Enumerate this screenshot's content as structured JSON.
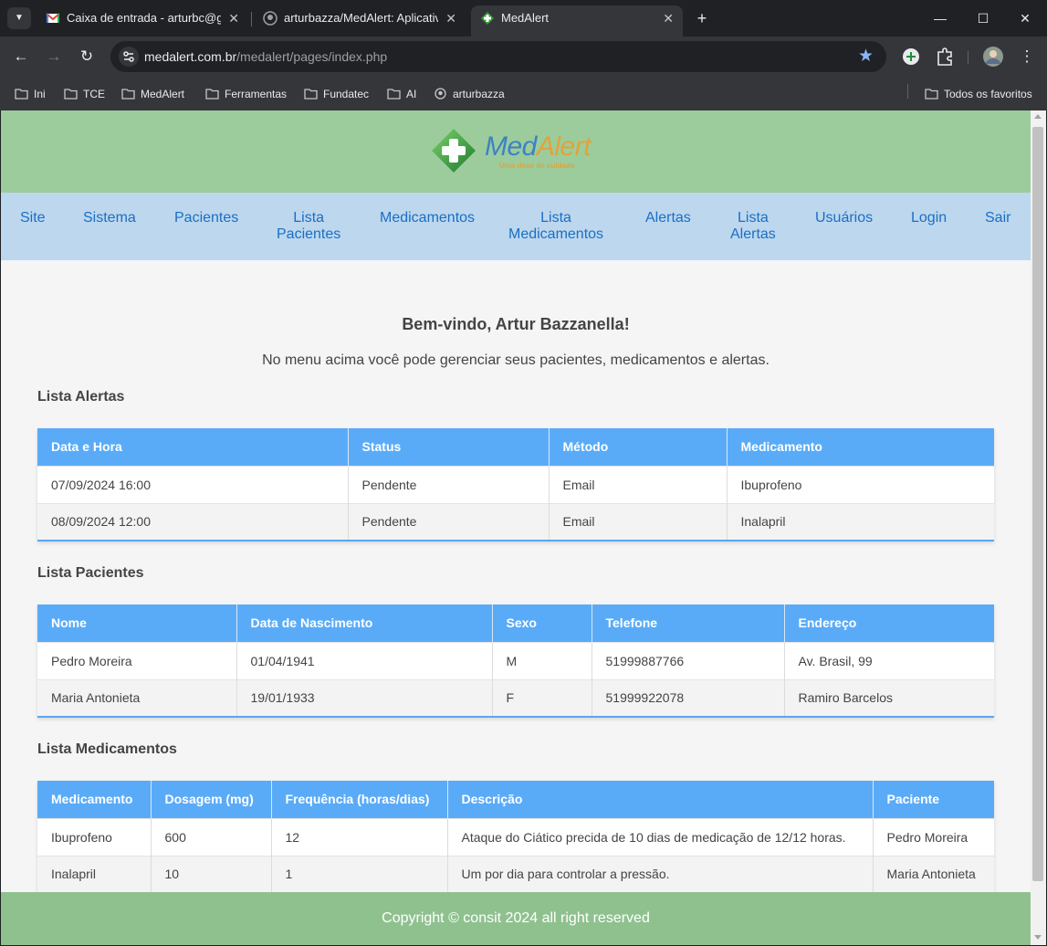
{
  "browser": {
    "tabs": [
      {
        "title": "Caixa de entrada - arturbc@gmail.com",
        "active": false
      },
      {
        "title": "arturbazza/MedAlert: Aplicativo",
        "active": false
      },
      {
        "title": "MedAlert",
        "active": true
      }
    ],
    "url_host": "medalert.com.br",
    "url_path": "/medalert/pages/index.php",
    "bookmarks": [
      "Ini",
      "TCE",
      "MedAlert",
      "Ferramentas",
      "Fundatec",
      "AI",
      "arturbazza"
    ],
    "all_bookmarks_label": "Todos os favoritos"
  },
  "site": {
    "logo": {
      "med": "Med",
      "alert": "Alert",
      "tagline": "Uma dose de cuidado"
    },
    "nav": [
      {
        "label": "Site"
      },
      {
        "label": "Sistema"
      },
      {
        "label": "Pacientes"
      },
      {
        "label": "Lista\nPacientes"
      },
      {
        "label": "Medicamentos"
      },
      {
        "label": "Lista\nMedicamentos"
      },
      {
        "label": "Alertas"
      },
      {
        "label": "Lista\nAlertas"
      },
      {
        "label": "Usuários"
      },
      {
        "label": "Login"
      },
      {
        "label": "Sair"
      }
    ],
    "welcome": "Bem-vindo, Artur Bazzanella!",
    "subtitle": "No menu acima você pode gerenciar seus pacientes, medicamentos e alertas.",
    "alerts": {
      "title": "Lista Alertas",
      "headers": [
        "Data e Hora",
        "Status",
        "Método",
        "Medicamento"
      ],
      "rows": [
        [
          "07/09/2024 16:00",
          "Pendente",
          "Email",
          "Ibuprofeno"
        ],
        [
          "08/09/2024 12:00",
          "Pendente",
          "Email",
          "Inalapril"
        ]
      ]
    },
    "patients": {
      "title": "Lista Pacientes",
      "headers": [
        "Nome",
        "Data de Nascimento",
        "Sexo",
        "Telefone",
        "Endereço"
      ],
      "rows": [
        [
          "Pedro Moreira",
          "01/04/1941",
          "M",
          "51999887766",
          "Av. Brasil, 99"
        ],
        [
          "Maria Antonieta",
          "19/01/1933",
          "F",
          "51999922078",
          "Ramiro Barcelos"
        ]
      ]
    },
    "medications": {
      "title": "Lista Medicamentos",
      "headers": [
        "Medicamento",
        "Dosagem (mg)",
        "Frequência (horas/dias)",
        "Descrição",
        "Paciente"
      ],
      "rows": [
        [
          "Ibuprofeno",
          "600",
          "12",
          "Ataque do Ciático precida de 10 dias de medicação de 12/12 horas.",
          "Pedro Moreira"
        ],
        [
          "Inalapril",
          "10",
          "1",
          "Um por dia para controlar a pressão.",
          "Maria Antonieta"
        ]
      ]
    },
    "footer": "Copyright © consit 2024 all right reserved"
  }
}
